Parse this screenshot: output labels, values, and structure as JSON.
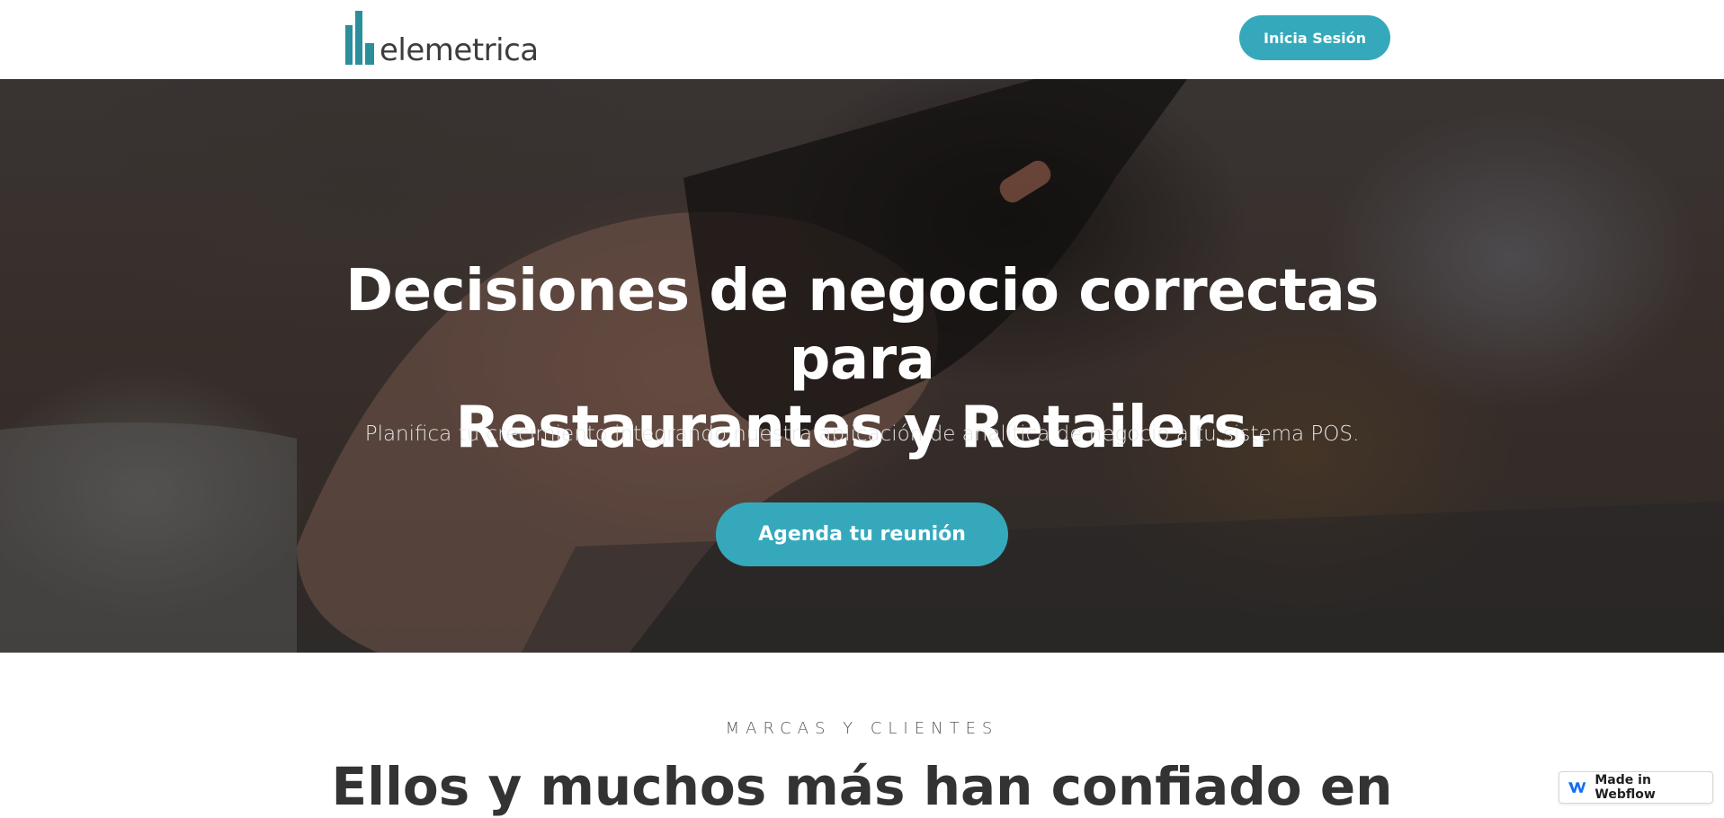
{
  "navbar": {
    "logo_text": "elemetrica",
    "login_label": "Inicia Sesión"
  },
  "hero": {
    "title_line1": "Decisiones de negocio correctas para",
    "title_line2": "Restaurantes y Retailers.",
    "subtitle": "Planifica tu crecimiento integrando nuestra aplicación de analítica de negocio a tu sistema POS.",
    "cta_label": "Agenda tu reunión"
  },
  "brands": {
    "eyebrow": "MARCAS Y CLIENTES",
    "title": "Ellos y muchos más han confiado en"
  },
  "badge": {
    "label": "Made in Webflow"
  },
  "colors": {
    "accent": "#35a9bb",
    "logo": "#2a8f9a",
    "heading_dark": "#333333"
  },
  "icons": {
    "logo_mark": "bar-chart-icon",
    "badge_icon": "webflow-icon"
  }
}
